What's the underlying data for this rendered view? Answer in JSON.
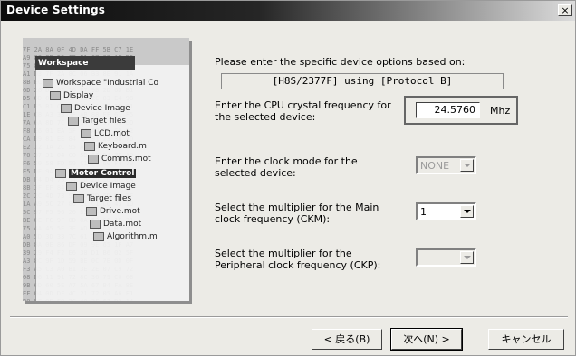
{
  "window": {
    "title": "Device Settings",
    "close_glyph": "×"
  },
  "wizard_image": {
    "workspace_label": "Workspace",
    "tree": [
      {
        "label": "Workspace \"Industrial Co",
        "icon": "workspace-icon"
      },
      {
        "label": "Display",
        "icon": "folder-icon"
      },
      {
        "label": "Device Image",
        "icon": "file-icon"
      },
      {
        "label": "Target files",
        "icon": "folder-icon"
      },
      {
        "label": "LCD.mot",
        "icon": "file-icon"
      },
      {
        "label": "Keyboard.m",
        "icon": "file-icon"
      },
      {
        "label": "Comms.mot",
        "icon": "file-icon"
      },
      {
        "label": "Motor Control",
        "icon": "folder-icon"
      },
      {
        "label": "Device Image",
        "icon": "file-icon"
      },
      {
        "label": "Target files",
        "icon": "folder-icon"
      },
      {
        "label": "Drive.mot",
        "icon": "file-icon"
      },
      {
        "label": "Data.mot",
        "icon": "file-icon"
      },
      {
        "label": "Algorithm.m",
        "icon": "file-icon"
      }
    ]
  },
  "intro": "Please enter the specific device options based on:",
  "device_info": "[H8S/2377F] using [Protocol B]",
  "cpu_freq": {
    "label_line1": "Enter the CPU crystal frequency for",
    "label_line2": "the selected device:",
    "value": "24.5760",
    "unit": "Mhz"
  },
  "clock_mode": {
    "label_line1": "Enter the clock mode for the",
    "label_line2": "selected device:",
    "value": "NONE"
  },
  "ckm": {
    "label_line1": "Select the multiplier for the Main",
    "label_line2": "clock frequency (CKM):",
    "value": "1"
  },
  "ckp": {
    "label_line1": "Select the multiplier for the",
    "label_line2": "Peripheral clock frequency (CKP):",
    "value": ""
  },
  "buttons": {
    "back": "< 戻る(B)",
    "next": "次へ(N) >",
    "cancel": "キャンセル"
  }
}
